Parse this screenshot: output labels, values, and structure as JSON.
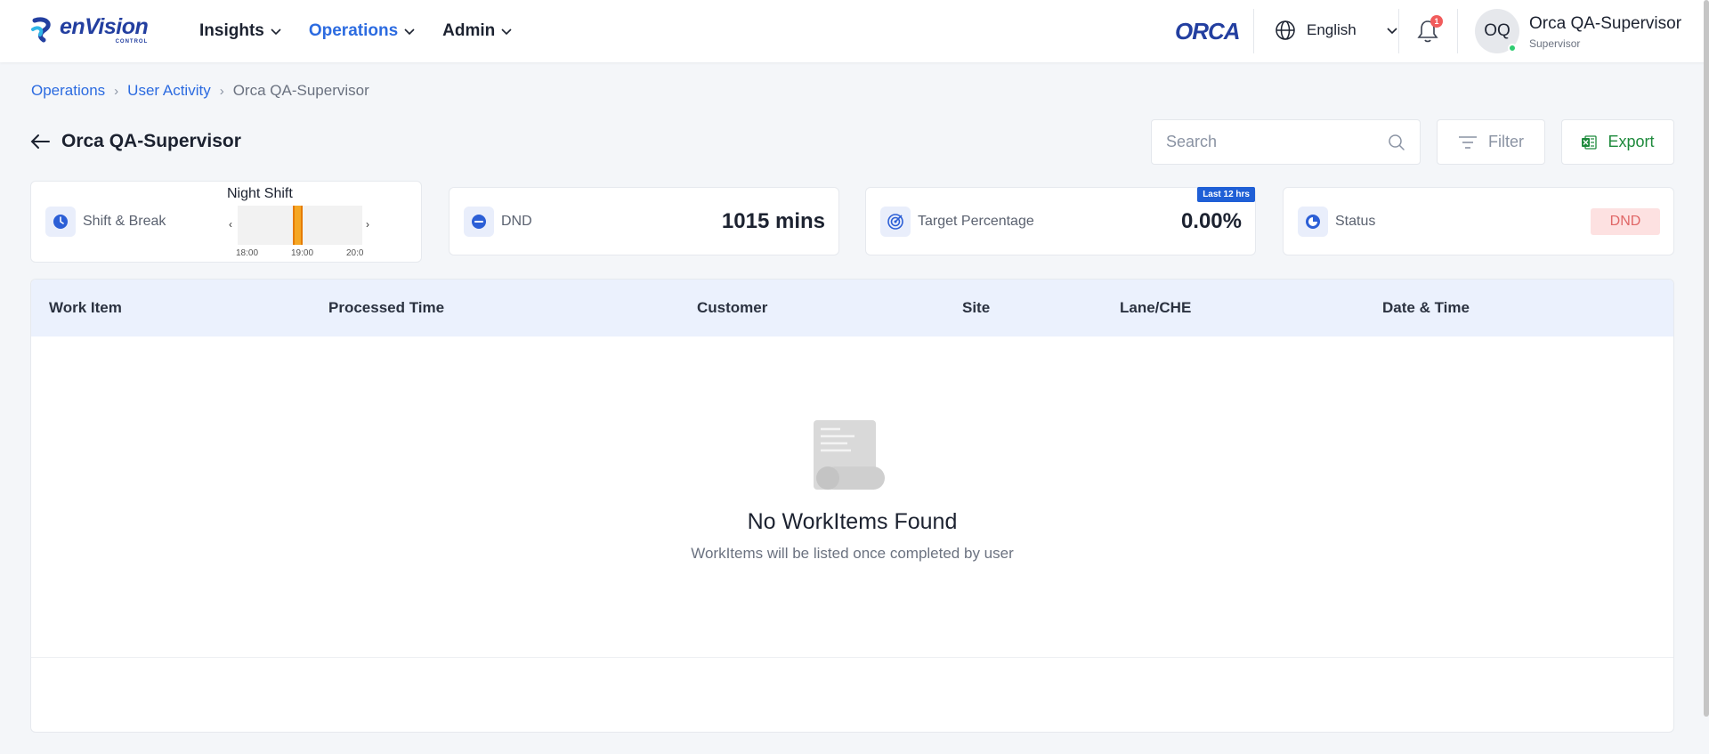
{
  "brand": {
    "logo_word": "enVision",
    "logo_sub": "CONTROL",
    "product_logo": "ORCA",
    "brand_color": "#233fa0"
  },
  "nav": {
    "items": [
      {
        "label": "Insights",
        "active": false
      },
      {
        "label": "Operations",
        "active": true
      },
      {
        "label": "Admin",
        "active": false
      }
    ]
  },
  "header": {
    "language": "English",
    "notification_count": "1",
    "user": {
      "initials": "OQ",
      "name": "Orca QA-Supervisor",
      "role": "Supervisor",
      "online": true
    }
  },
  "breadcrumb": {
    "items": [
      "Operations",
      "User Activity"
    ],
    "current": "Orca QA-Supervisor"
  },
  "page": {
    "title": "Orca QA-Supervisor",
    "search_placeholder": "Search",
    "filter_label": "Filter",
    "export_label": "Export"
  },
  "cards": {
    "shift": {
      "label": "Shift & Break",
      "shift_name": "Night Shift",
      "timeline_start": "18:00",
      "timeline_ticks": [
        "18:00",
        "19:00",
        "20:0"
      ],
      "highlight_start": "19:00",
      "highlight_fraction": 0.08
    },
    "dnd": {
      "label": "DND",
      "value": "1015 mins"
    },
    "target": {
      "label": "Target Percentage",
      "value": "0.00%",
      "badge": "Last 12 hrs"
    },
    "status": {
      "label": "Status",
      "value": "DND"
    }
  },
  "table": {
    "columns": [
      "Work Item",
      "Processed Time",
      "Customer",
      "Site",
      "Lane/CHE",
      "Date & Time"
    ],
    "rows": [],
    "empty_title": "No WorkItems Found",
    "empty_subtitle": "WorkItems will be listed once completed by user"
  },
  "colors": {
    "accent": "#2c6be0",
    "export_green": "#1e8a3c",
    "status_bg": "#fde1e1",
    "status_text": "#e06666",
    "shift_bar": "#f5a623",
    "table_header_bg": "#ebf1fd"
  },
  "icons": {
    "back": "arrow-left-icon",
    "search": "search-icon",
    "filter": "filter-icon",
    "export": "excel-icon",
    "language": "globe-icon",
    "notifications": "bell-icon",
    "shift": "clock-icon",
    "dnd": "minus-circle-icon",
    "target": "target-icon",
    "status": "status-icon",
    "empty": "document-scroll-icon"
  }
}
